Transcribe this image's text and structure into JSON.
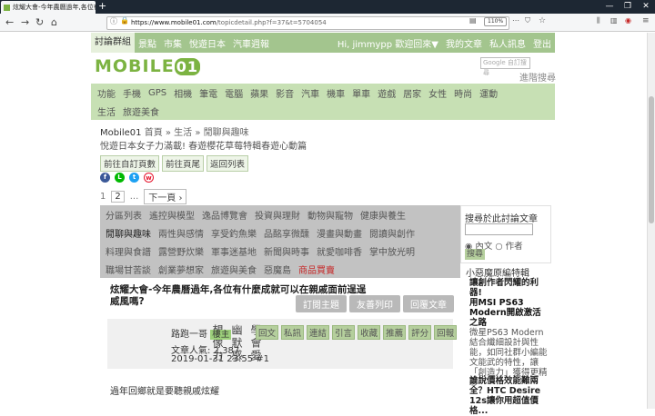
{
  "browser": {
    "tab_title": "炫耀大會-今年農曆過年,各位有",
    "new_tab": "+",
    "url_host": "https://www.mobile01.com",
    "url_path": "/topicdetail.php?f=37&t=5704054",
    "zoom": "110%"
  },
  "site_nav": {
    "items": [
      "討論群組",
      "景點",
      "市集",
      "悅遊日本",
      "汽車週報"
    ],
    "user_greeting": "Hi, jimmypp 歡迎回來▼",
    "user_links": [
      "我的文章",
      "私人訊息",
      "登出"
    ]
  },
  "logo": {
    "text": "MOBILE",
    "badge": "01"
  },
  "search": {
    "placeholder": "Google 自訂搜尋",
    "button": "搜尋",
    "advanced": "進階搜尋"
  },
  "categories": {
    "row1": [
      "功能",
      "手機",
      "GPS",
      "相機",
      "筆電",
      "電腦",
      "蘋果",
      "影音",
      "汽車",
      "機車",
      "單車",
      "遊戲",
      "居家",
      "女性",
      "時尚",
      "運動"
    ],
    "row2": [
      "生活",
      "旅遊美食"
    ]
  },
  "breadcrumb": {
    "home": "Mobile01",
    "path": " 首頁 » 生活 » 閒聊與趣味"
  },
  "promo": "悅遊日本女子力滿載! 春遊櫻花草莓特輯春遊心動篇",
  "page_buttons": [
    "前往自訂頁數",
    "前往頁尾",
    "返回列表"
  ],
  "pager": {
    "pages": [
      "1",
      "2"
    ],
    "current": "2",
    "ellipsis": "...",
    "next": "下一頁 ›"
  },
  "subcats": {
    "row1": [
      "分區列表",
      "遙控與模型",
      "逸品博覽會",
      "投資與理財",
      "動物與寵物",
      "健康與養生"
    ],
    "row2": [
      "閒聊與趣味",
      "兩性與感情",
      "享受釣魚樂",
      "品酩享微醺",
      "漫畫與動畫",
      "閱讀與創作"
    ],
    "row3": [
      "料理與食譜",
      "露營野炊樂",
      "軍事迷基地",
      "新聞與時事",
      "就愛咖啡香",
      "掌中放光明"
    ],
    "row4": [
      "職場甘苦談",
      "創業夢想家",
      "旅遊與美食",
      "惡魔島"
    ],
    "row4_red": "商品買賣"
  },
  "forum_search": {
    "title": "搜尋於此討論文章",
    "opt_content": "內文",
    "opt_author": "作者",
    "button": "搜尋"
  },
  "post": {
    "title": "炫耀大會-今年農曆過年,各位有什麼成就可以在親戚面前逞逞威風嗎?",
    "actions": [
      "訂閱主題",
      "友善列印",
      "回覆文章"
    ],
    "motto_cols": [
      "學會愛",
      "幽默感",
      "想像力"
    ],
    "author": "路跑一哥",
    "author_badge": "樓主",
    "tools": [
      "回文",
      "私訊",
      "連結",
      "引言",
      "收藏",
      "推薦",
      "評分",
      "回報"
    ],
    "views_label": "文章人氣: 2,387",
    "time": "2019-01-31 23:55  #1",
    "content": "過年回鄉就是要聽親戚炫耀"
  },
  "sidebar": {
    "title": "小惡魔原編特輯",
    "items": [
      {
        "head": "讓創作者閃耀的利器!",
        "title": "用MSI PS63 Modern開啟激活之路",
        "body": "微星PS63 Modern結合纖細設計與性能，如同社群小編能文能武的特性，讓「創造力」獲得更精彩"
      },
      {
        "head": "",
        "title": "誰說價格效能難兩全？HTC Desire 12s讓你用超值價格...",
        "body": ""
      }
    ]
  }
}
